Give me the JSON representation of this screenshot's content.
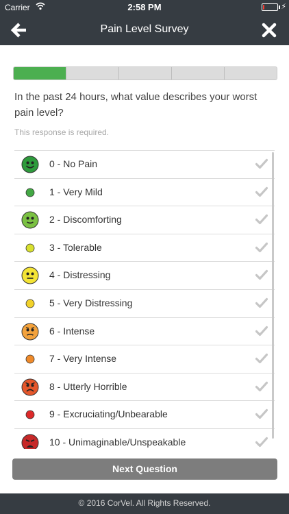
{
  "status_bar": {
    "carrier": "Carrier",
    "time": "2:58 PM",
    "battery_percent": 10
  },
  "nav": {
    "title": "Pain Level Survey",
    "back_icon": "arrow-left-icon",
    "close_icon": "close-icon"
  },
  "progress": {
    "segments_total": 5,
    "segments_completed": 1,
    "completed_color": "#4caf50"
  },
  "question": {
    "text": "In the past 24 hours, what value describes your worst pain level?",
    "required_note": "This response is required."
  },
  "options": [
    {
      "label": "0 - No Pain",
      "icon": "smiley-face-icon",
      "color": "#2e9b3c",
      "face": "happy"
    },
    {
      "label": "1 - Very Mild",
      "icon": "dot-icon",
      "color": "#43a844",
      "face": "dot"
    },
    {
      "label": "2 - Discomforting",
      "icon": "slight-smile-face-icon",
      "color": "#7bc142",
      "face": "slight"
    },
    {
      "label": "3 - Tolerable",
      "icon": "dot-icon",
      "color": "#d8e02f",
      "face": "dot"
    },
    {
      "label": "4 - Distressing",
      "icon": "neutral-face-icon",
      "color": "#f4e435",
      "face": "neutral"
    },
    {
      "label": "5 - Very Distressing",
      "icon": "dot-icon",
      "color": "#f2d22b",
      "face": "dot"
    },
    {
      "label": "6 - Intense",
      "icon": "worried-face-icon",
      "color": "#f3a23c",
      "face": "worried"
    },
    {
      "label": "7 - Very Intense",
      "icon": "dot-icon",
      "color": "#ef8a2a",
      "face": "dot"
    },
    {
      "label": "8 - Utterly Horrible",
      "icon": "sad-face-icon",
      "color": "#e5572b",
      "face": "sad"
    },
    {
      "label": "9 - Excruciating/Unbearable",
      "icon": "dot-icon",
      "color": "#dd2a2a",
      "face": "dot"
    },
    {
      "label": "10 - Unimaginable/Unspeakable",
      "icon": "crying-face-icon",
      "color": "#c62828",
      "face": "cry"
    }
  ],
  "next_button": {
    "label": "Next Question"
  },
  "footer": {
    "text": "© 2016 CorVel. All Rights Reserved."
  }
}
